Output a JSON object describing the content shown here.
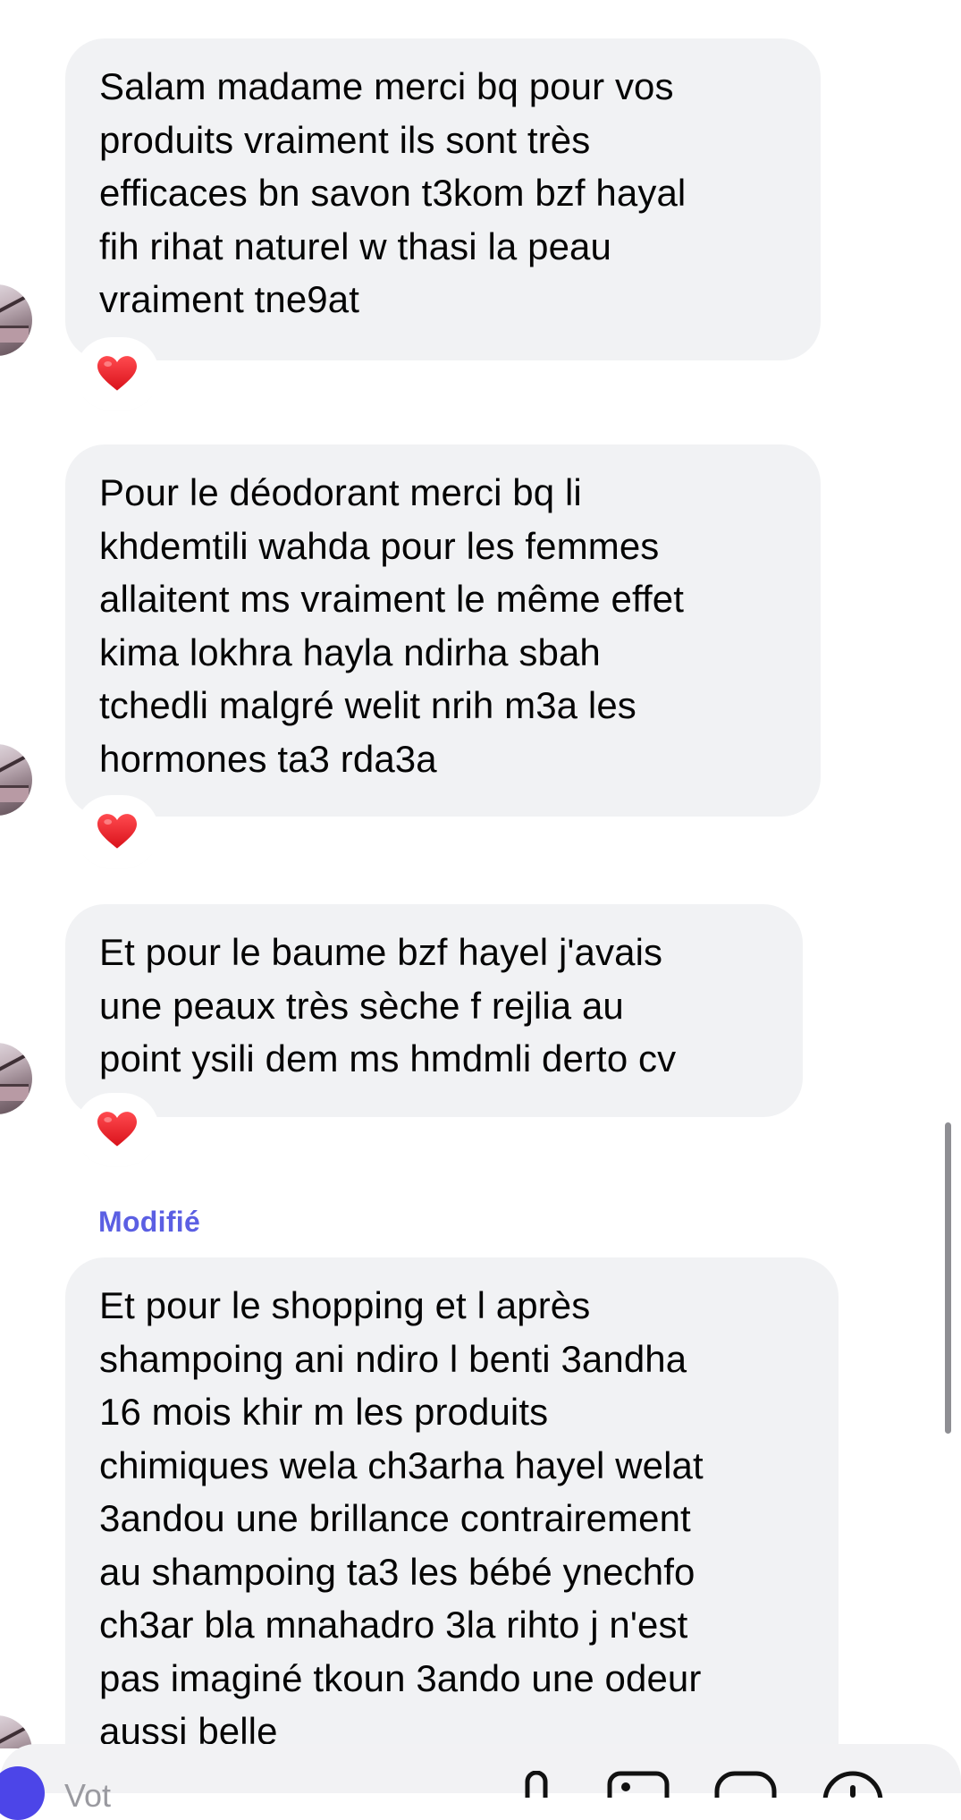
{
  "messages": [
    {
      "text": "Salam madame merci bq pour vos\nproduits vraiment ils sont très\nefficaces bn savon t3kom bzf hayal\nfih rihat naturel w thasi la peau\nvraiment tne9at",
      "reaction": "heart"
    },
    {
      "text": "Pour le déodorant merci bq li\nkhdemtili wahda pour les femmes\nallaitent ms vraiment le même effet\nkima lokhra hayla ndirha sbah\ntchedli malgré welit nrih m3a les\nhormones ta3 rda3a",
      "reaction": "heart"
    },
    {
      "text": "Et pour le baume bzf hayel j'avais\nune peaux très sèche f rejlia au\npoint ysili dem ms hmdmli derto cv",
      "reaction": "heart"
    },
    {
      "edited_label": "Modifié",
      "text": "Et pour le shopping et l après\nshampoing ani ndiro l benti 3andha\n16 mois khir m les produits\nchimiques wela ch3arha hayel welat\n3andou une brillance contrairement\nau shampoing ta3 les bébé ynechfo\nch3ar bla mnahadro 3la rihto j n'est\npas imaginé tkoun 3ando une odeur\naussi belle"
    }
  ],
  "composer": {
    "placeholder": "Vot",
    "icons": [
      "plus-icon",
      "microphone-icon",
      "image-icon",
      "sticker-icon",
      "emoji-icon"
    ]
  },
  "colors": {
    "bubble": "#f1f2f4",
    "edited_label": "#5b5fe3",
    "heart": "#e8202a",
    "composer_accent": "#4c45e8"
  }
}
